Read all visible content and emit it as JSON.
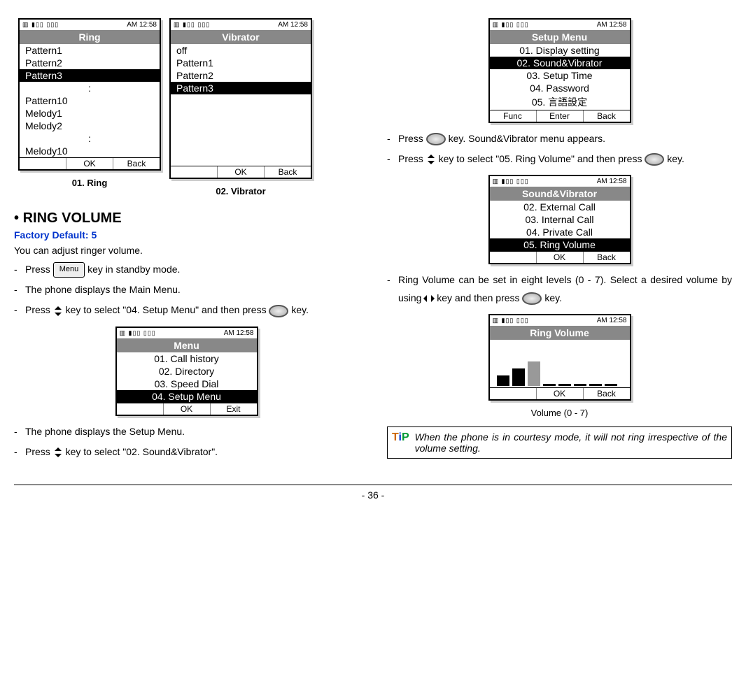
{
  "time": "AM 12:58",
  "status_icons": "▥ ▮▯▯ ▯▯▯",
  "ring_screen": {
    "title": "Ring",
    "items": [
      "Pattern1",
      "Pattern2",
      "Pattern3",
      ":",
      "Pattern10",
      "Melody1",
      "Melody2",
      ":",
      "Melody10"
    ],
    "selected_index": 2,
    "soft": [
      "",
      "OK",
      "Back"
    ],
    "caption": "01. Ring"
  },
  "vibrator_screen": {
    "title": "Vibrator",
    "items": [
      "off",
      "Pattern1",
      "Pattern2",
      "Pattern3"
    ],
    "selected_index": 3,
    "soft": [
      "",
      "OK",
      "Back"
    ],
    "caption": "02. Vibrator"
  },
  "section_title": "RING VOLUME",
  "factory_default": "Factory Default: 5",
  "intro": "You can adjust ringer volume.",
  "steps_left": {
    "s1a": "Press ",
    "s1b": " key in standby mode.",
    "s2": "The phone displays the Main Menu.",
    "s3a": "Press ",
    "s3b": " key to select \"04. Setup Menu\" and then press ",
    "s3c": " key.",
    "s4": "The phone displays the Setup Menu.",
    "s5a": "Press ",
    "s5b": " key to select \"02. Sound&Vibrator\"."
  },
  "menu_key_label": "Menu",
  "menu_screen": {
    "title": "Menu",
    "items": [
      "01. Call history",
      "02. Directory",
      "03. Speed Dial",
      "04. Setup Menu"
    ],
    "selected_index": 3,
    "soft": [
      "",
      "OK",
      "Exit"
    ]
  },
  "setup_screen": {
    "title": "Setup Menu",
    "items": [
      "01. Display setting",
      "02. Sound&Vibrator",
      "03. Setup Time",
      "04. Password",
      "05. 言語設定"
    ],
    "selected_index": 1,
    "soft": [
      "Func",
      "Enter",
      "Back"
    ]
  },
  "steps_right": {
    "r1a": "Press ",
    "r1b": " key. Sound&Vibrator menu appears.",
    "r2a": "Press ",
    "r2b": " key to select \"05. Ring Volume\" and then press ",
    "r2c": " key."
  },
  "sound_screen": {
    "title": "Sound&Vibrator",
    "items": [
      "02. External Call",
      "03. Internal Call",
      "04. Private Call",
      "05. Ring Volume"
    ],
    "selected_index": 3,
    "soft": [
      "",
      "OK",
      "Back"
    ]
  },
  "steps_right2": {
    "r3a": "Ring Volume can be set in eight levels (0 - 7). Select a desired volume by using ",
    "r3b": " key and then press ",
    "r3c": " key."
  },
  "volume_screen": {
    "title": "Ring Volume",
    "soft": [
      "",
      "OK",
      "Back"
    ],
    "caption": "Volume (0 - 7)"
  },
  "tip": "When the phone is in courtesy mode, it will not ring irrespective of the volume setting.",
  "page_number": "- 36 -"
}
